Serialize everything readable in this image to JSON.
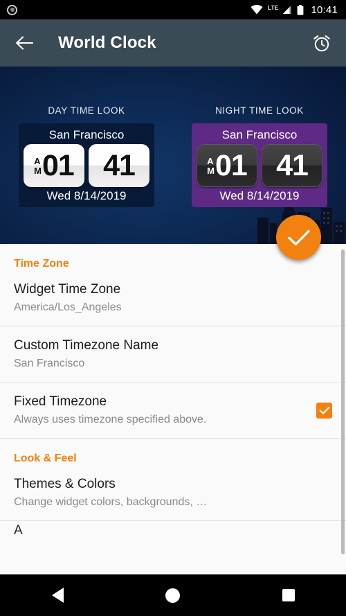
{
  "statusbar": {
    "time": "10:41",
    "lte_label": "LTE",
    "icons": [
      "camera-dot-icon",
      "wifi-icon",
      "signal-icon",
      "battery-icon"
    ]
  },
  "appbar": {
    "title": "World Clock",
    "back_icon": "back-arrow-icon",
    "action_icon": "alarm-clock-icon"
  },
  "hero": {
    "day": {
      "look_label": "DAY TIME LOOK",
      "city": "San Francisco",
      "ampm_a": "A",
      "ampm_m": "M",
      "hours": "01",
      "minutes": "41",
      "date": "Wed 8/14/2019",
      "card_color": "#071a37"
    },
    "night": {
      "look_label": "NIGHT TIME LOOK",
      "city": "San Francisco",
      "ampm_a": "A",
      "ampm_m": "M",
      "hours": "01",
      "minutes": "41",
      "date": "Wed 8/14/2019",
      "card_color": "#5e2a86"
    }
  },
  "fab": {
    "icon": "check-icon",
    "color": "#f2810f"
  },
  "sections": [
    {
      "header": "Time Zone",
      "rows": [
        {
          "title": "Widget Time Zone",
          "summary": "America/Los_Angeles"
        },
        {
          "title": "Custom Timezone Name",
          "summary": "San Francisco"
        },
        {
          "title": "Fixed Timezone",
          "summary": "Always uses timezone specified above.",
          "checkbox": true
        }
      ]
    },
    {
      "header": "Look & Feel",
      "rows": [
        {
          "title": "Themes & Colors",
          "summary": "Change widget colors, backgrounds, …"
        }
      ]
    }
  ],
  "navbar": {
    "back": "nav-back-icon",
    "home": "nav-home-icon",
    "recents": "nav-recents-icon"
  },
  "accent_color": "#f2810f"
}
